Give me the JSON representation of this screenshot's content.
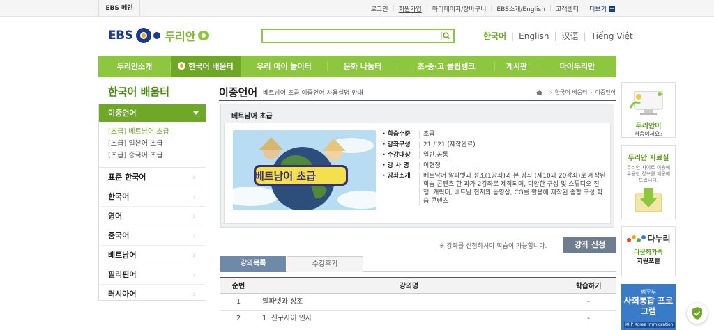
{
  "topbar": {
    "home_label": "EBS 메인",
    "links": [
      "로그인",
      "회원가입",
      "마이페이지/장바구니",
      "EBS소개/English",
      "고객센터"
    ],
    "favorite_label": "더보기"
  },
  "header": {
    "logo_text": "EBS",
    "brand": "두리안",
    "search": {
      "value": "",
      "placeholder": ""
    },
    "languages": [
      "한국어",
      "English",
      "汉语",
      "Tiếng Việt"
    ],
    "active_language": "한국어"
  },
  "nav": {
    "items": [
      "두리안소개",
      "한국어 배움터",
      "우리 아이 놀이터",
      "문화 나눔터",
      "초·중·고 클립뱅크",
      "게시판",
      "마이두리안"
    ],
    "active": "한국어 배움터"
  },
  "sidebar": {
    "title": "한국어 배움터",
    "active_section": "이중언어",
    "sub_items": [
      {
        "label": "[초급] 베트남어 초급",
        "active": true
      },
      {
        "label": "[초급] 일본어 초급",
        "active": false
      },
      {
        "label": "[초급] 중국어 초급",
        "active": false
      }
    ],
    "sections": [
      "표준 한국어",
      "한국어",
      "영어",
      "중국어",
      "베트남어",
      "필리핀어",
      "러시아어"
    ]
  },
  "content": {
    "title": "이중언어",
    "description": "베트남어 초급 이중언어 사용설명 안내",
    "breadcrumb": [
      "한국어 배움터",
      "이중언어"
    ],
    "course": {
      "name": "베트남어 초급",
      "thumbnail_caption": "베트남어 초급",
      "fields": [
        {
          "label": "학습수준",
          "value": "초급"
        },
        {
          "label": "강좌구성",
          "value": "21 / 21 (제작완료)"
        },
        {
          "label": "수강대상",
          "value": "일반,공통"
        },
        {
          "label": "강 사 명",
          "value": "이현정"
        },
        {
          "label": "강좌소개",
          "value": "베트남어 알파벳과 성조(1강좌)과 본 강좌 (제10과 20강좌)로 제작된 학습 콘텐츠 한 과가 2강좌로 제작되며, 다양한 구성 및 스튜디오 진행, 캐릭터, 베트남 현지의 동영상, CG를 활용해 제작된 종합 구성 학습 콘텐츠"
        }
      ]
    },
    "notice": "※ 강좌를 신청하셔야 학습이 가능합니다.",
    "apply_button": "강좌 신청",
    "tabs": [
      "강의목록",
      "수강후기"
    ],
    "active_tab": "강의목록",
    "table": {
      "headers": [
        "순번",
        "강의명",
        "학습하기"
      ],
      "rows": [
        [
          "1",
          "알파벳과 성조",
          "-"
        ],
        [
          "2",
          "1. 친구사이 인사",
          "-"
        ]
      ]
    }
  },
  "banners": {
    "first": {
      "title": "두리안이",
      "subtitle": "처음이세요?"
    },
    "second": {
      "title": "두리안 자료실",
      "desc": "두리안 사이트 이용에 유용한 정보를 제공해 드립니다."
    },
    "third": {
      "logo_text": "다누리",
      "title": "다문화가족",
      "subtitle": "지원포털"
    },
    "fourth": {
      "small": "법무부",
      "title": "사회통합 프로그램",
      "kiip": "KIIP Korea Immigration"
    }
  },
  "colors": {
    "brand_green": "#8dc63f",
    "active_green": "#6fa826",
    "navy": "#1b3a8c",
    "tab_blue": "#6f8aa8"
  }
}
